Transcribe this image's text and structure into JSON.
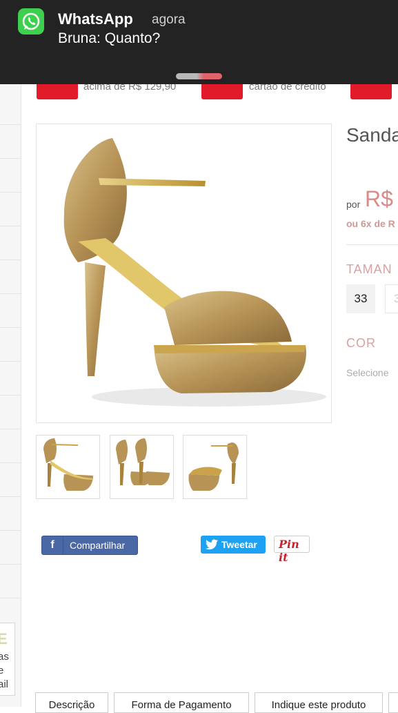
{
  "notification": {
    "app": "WhatsApp",
    "time": "agora",
    "message": "Bruna: Quanto?"
  },
  "strip": {
    "shipping_text": "acima de R$ 129,90",
    "card_text": "cartão de crédito"
  },
  "product": {
    "title": "Sanda",
    "price_prefix": "por",
    "price": "R$",
    "installments": "ou 6x de R",
    "size_label": "TAMAN",
    "sizes": [
      "33",
      "3"
    ],
    "color_label": "COR",
    "color_placeholder": "Selecione"
  },
  "share": {
    "facebook": "Compartilhar",
    "twitter": "Tweetar",
    "pinterest": "Pin it"
  },
  "tabs": [
    "Descrição",
    "Forma de Pagamento",
    "Indique este produto"
  ],
  "sidebar": {
    "box_big": "E",
    "box_lines": [
      "as",
      "e",
      "ail"
    ]
  },
  "colors": {
    "whatsapp_green": "#3fcf4f",
    "accent_red": "#e21b2b",
    "price_pink": "#d98a8a",
    "facebook_blue": "#4a67a6",
    "twitter_blue": "#1da1f2",
    "pinterest_red": "#c8232c"
  },
  "icons": [
    "whatsapp-icon",
    "truck-icon",
    "credit-card-icon",
    "facebook-icon",
    "twitter-bird-icon"
  ]
}
